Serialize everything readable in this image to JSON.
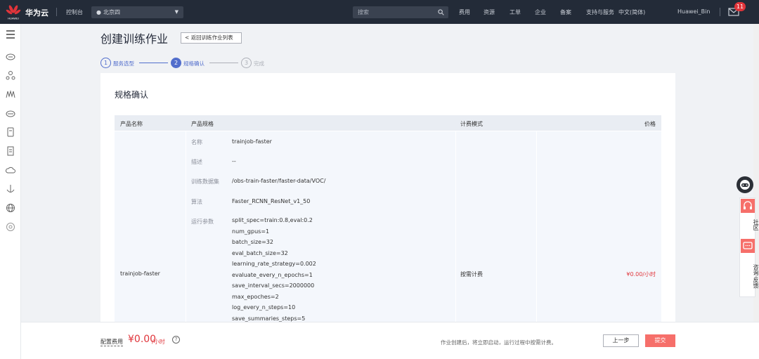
{
  "topbar": {
    "logo_text": "HUAWEI",
    "brand": "华为云",
    "console": "控制台",
    "region": "北京四",
    "search_placeholder": "搜索",
    "nav": [
      "费用",
      "资源",
      "工单",
      "企业",
      "备案",
      "支持与服务"
    ],
    "language": "中文(简体)",
    "user": "Huawei_Bin",
    "mail_badge": "11"
  },
  "page": {
    "title": "创建训练作业",
    "back_label": "< 返回训练作业列表"
  },
  "steps": [
    {
      "number": "1",
      "label": "服务选型",
      "state": "done"
    },
    {
      "number": "2",
      "label": "规格确认",
      "state": "active"
    },
    {
      "number": "3",
      "label": "完成",
      "state": "pending"
    }
  ],
  "panel": {
    "title": "规格确认",
    "columns": [
      "产品名称",
      "产品规格",
      "计费模式",
      "价格"
    ],
    "product_name": "trainjob-faster",
    "billing_mode": "按需计费",
    "price": "¥0.00/小时",
    "specs": [
      {
        "label": "名称",
        "value": "trainjob-faster"
      },
      {
        "label": "描述",
        "value": "--"
      },
      {
        "label": "训练数据集",
        "value": "/obs-train-faster/faster-data/VOC/"
      },
      {
        "label": "算法",
        "value": "Faster_RCNN_ResNet_v1_50"
      }
    ],
    "params_label": "运行参数",
    "params": [
      "split_spec=train:0.8,eval:0.2",
      "num_gpus=1",
      "batch_size=32",
      "eval_batch_size=32",
      "learning_rate_strategy=0.002",
      "evaluate_every_n_epochs=1",
      "save_interval_secs=2000000",
      "max_epoches=2",
      "log_every_n_steps=10",
      "save_summaries_steps=5"
    ]
  },
  "footer": {
    "fee_label": "配置费用",
    "fee_price": "¥0.00",
    "fee_unit": "/小时",
    "help": "?",
    "note": "作业创建后，将立即启动，运行过程中按需计费。",
    "prev_label": "上一步",
    "submit_label": "提交"
  },
  "float_panel": {
    "community": "社区",
    "feedback": "咨询·反馈"
  },
  "colors": {
    "topbar": "#232b38",
    "accent_blue": "#526ecc",
    "price_red": "#e0343a",
    "submit": "#f66f6a"
  }
}
